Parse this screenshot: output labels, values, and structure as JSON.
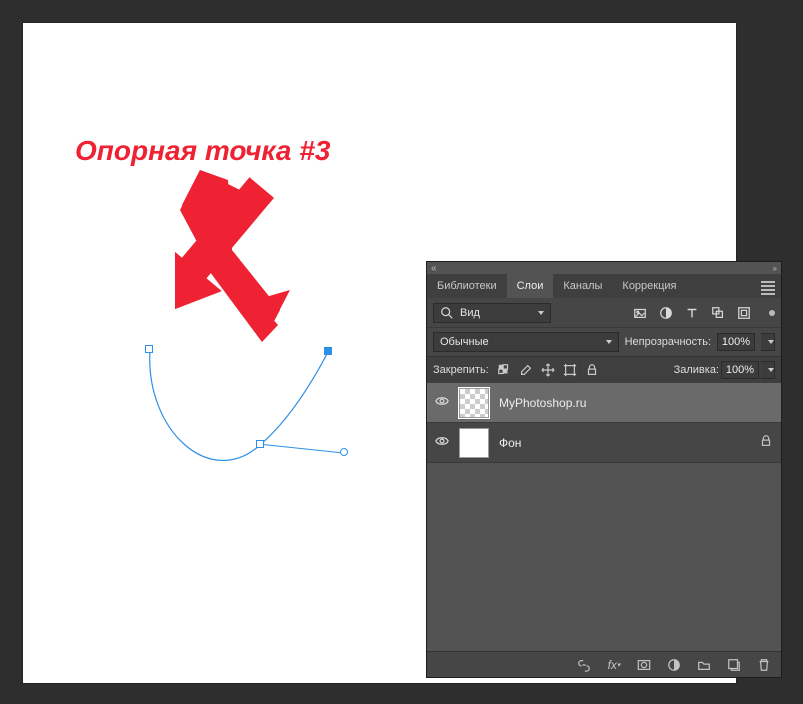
{
  "annotation": {
    "text": "Опорная точка #3"
  },
  "panel": {
    "tabs": {
      "libraries": "Библиотеки",
      "layers": "Слои",
      "channels": "Каналы",
      "adjustments": "Коррекция"
    },
    "filter": {
      "search_label": "Вид"
    },
    "blend_mode": "Обычные",
    "opacity_label": "Непрозрачность:",
    "opacity_value": "100%",
    "lock_label": "Закрепить:",
    "fill_label": "Заливка:",
    "fill_value": "100%",
    "layers": [
      {
        "name": "MyPhotoshop.ru",
        "selected": true,
        "checker": true,
        "locked": false
      },
      {
        "name": "Фон",
        "selected": false,
        "checker": false,
        "locked": true
      }
    ]
  }
}
